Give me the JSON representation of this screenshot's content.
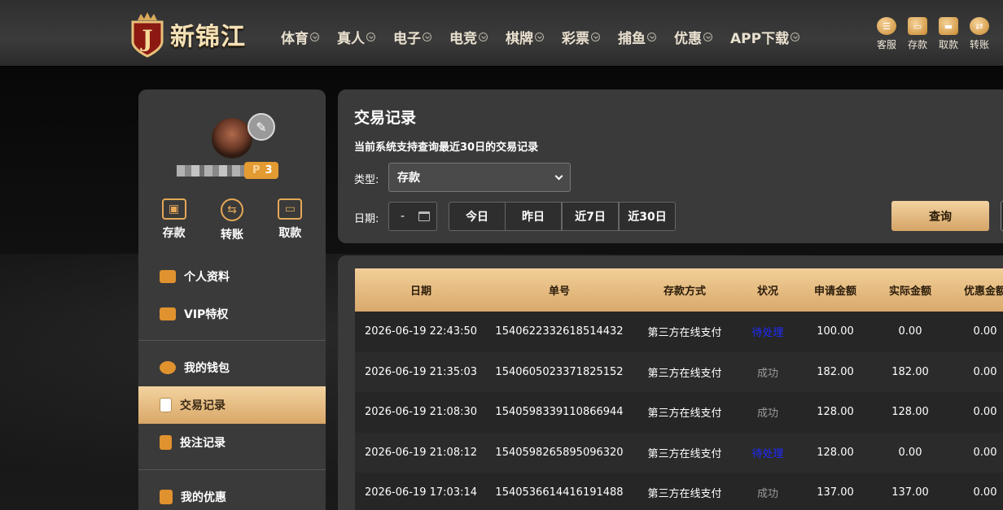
{
  "header": {
    "logo_text": "新锦江",
    "logo_letter": "J",
    "nav": [
      "体育",
      "真人",
      "电子",
      "电竞",
      "棋牌",
      "彩票",
      "捕鱼",
      "优惠",
      "APP下载"
    ],
    "tools": [
      {
        "label": "客服",
        "icon": "chat-icon"
      },
      {
        "label": "存款",
        "icon": "wallet-icon"
      },
      {
        "label": "取款",
        "icon": "purse-icon"
      },
      {
        "label": "转账",
        "icon": "transfer-icon"
      }
    ]
  },
  "sidebar": {
    "vip_level": "3",
    "vip_prefix": "P",
    "wallet_actions": [
      {
        "label": "存款",
        "icon": "wallet-icon"
      },
      {
        "label": "转账",
        "icon": "transfer-icon"
      },
      {
        "label": "取款",
        "icon": "card-icon"
      }
    ],
    "menu": [
      {
        "label": "个人资料",
        "icon": "id-card-icon"
      },
      {
        "label": "VIP特权",
        "icon": "vip-card-icon"
      },
      {
        "label": "我的钱包",
        "icon": "piggy-bank-icon"
      },
      {
        "label": "交易记录",
        "icon": "document-icon",
        "active": true
      },
      {
        "label": "投注记录",
        "icon": "clipboard-icon"
      },
      {
        "label": "我的优惠",
        "icon": "gift-icon"
      }
    ]
  },
  "filter": {
    "title": "交易记录",
    "subtitle": "当前系统支持查询最近30日的交易记录",
    "type_label": "类型:",
    "type_value": "存款",
    "date_label": "日期:",
    "date_value": "-",
    "quick_ranges": [
      "今日",
      "昨日",
      "近7日",
      "近30日"
    ],
    "query_label": "查询"
  },
  "table": {
    "columns": [
      "日期",
      "单号",
      "存款方式",
      "状况",
      "申请金额",
      "实际金额",
      "优惠金额"
    ],
    "rows": [
      [
        "2026-06-19 22:43:50",
        "1540622332618514432",
        "第三方在线支付",
        "待处理",
        "100.00",
        "0.00",
        "0.00"
      ],
      [
        "2026-06-19 21:35:03",
        "1540605023371825152",
        "第三方在线支付",
        "成功",
        "182.00",
        "182.00",
        "0.00"
      ],
      [
        "2026-06-19 21:08:30",
        "1540598339110866944",
        "第三方在线支付",
        "成功",
        "128.00",
        "128.00",
        "0.00"
      ],
      [
        "2026-06-19 21:08:12",
        "1540598265895096320",
        "第三方在线支付",
        "待处理",
        "128.00",
        "0.00",
        "0.00"
      ],
      [
        "2026-06-19 17:03:14",
        "1540536614416191488",
        "第三方在线支付",
        "成功",
        "137.00",
        "137.00",
        "0.00"
      ]
    ],
    "status_colors": {
      "待处理": "#1d2bff",
      "成功": "#9a9a9a"
    }
  }
}
